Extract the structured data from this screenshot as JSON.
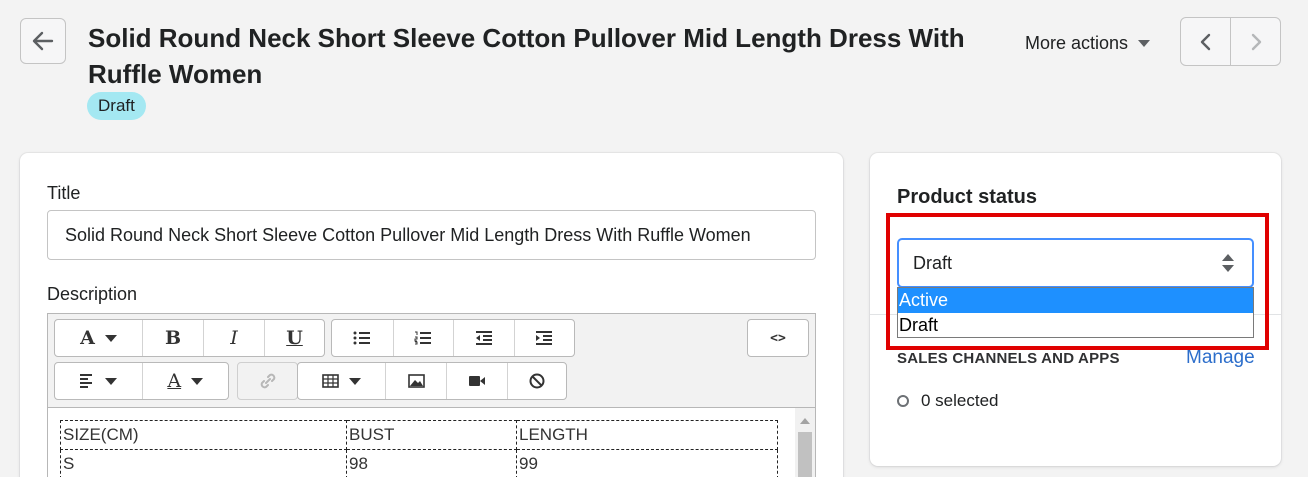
{
  "header": {
    "title": "Solid Round Neck Short Sleeve Cotton Pullover Mid Length Dress With Ruffle Women",
    "badge": "Draft",
    "more_actions": "More actions"
  },
  "main": {
    "title_label": "Title",
    "title_value": "Solid Round Neck Short Sleeve Cotton Pullover Mid Length Dress With Ruffle Women",
    "description_label": "Description",
    "toolbar": {
      "font_glyph": "A",
      "bold": "B",
      "italic": "I",
      "underline": "U",
      "source": "<>",
      "text_color_glyph": "A"
    },
    "table": {
      "headers": [
        "SIZE(CM)",
        "BUST",
        "LENGTH"
      ],
      "rows": [
        [
          "S",
          "98",
          "99"
        ]
      ]
    }
  },
  "sidebar": {
    "status_title": "Product status",
    "status_value": "Draft",
    "status_options": [
      "Active",
      "Draft"
    ],
    "channels_label": "SALES CHANNELS AND APPS",
    "manage_label": "Manage",
    "selected_text": "0 selected"
  },
  "colors": {
    "highlight": "#e00000",
    "selected_option": "#1e90ff",
    "badge": "#a4e8f2",
    "link": "#2c6ecb"
  }
}
